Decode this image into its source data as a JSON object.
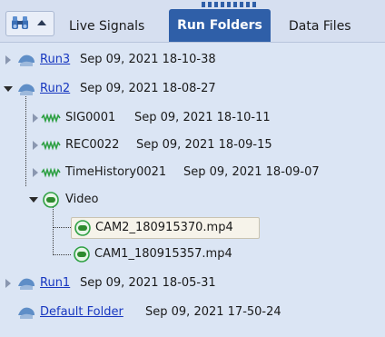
{
  "toolbar": {
    "search_icon": "binoculars-icon",
    "tabs": [
      {
        "label": "Live Signals",
        "active": false
      },
      {
        "label": "Run Folders",
        "active": true
      },
      {
        "label": "Data Files",
        "active": false
      }
    ]
  },
  "tree": {
    "run3": {
      "name": "Run3",
      "date": "Sep 09, 2021 18-10-38",
      "expanded": false
    },
    "run2": {
      "name": "Run2",
      "date": "Sep 09, 2021 18-08-27",
      "expanded": true,
      "children": {
        "sig": {
          "name": "SIG0001",
          "date": "Sep 09, 2021 18-10-11"
        },
        "rec": {
          "name": "REC0022",
          "date": "Sep 09, 2021 18-09-15"
        },
        "th": {
          "name": "TimeHistory0021",
          "date": "Sep 09, 2021 18-09-07"
        },
        "video": {
          "name": "Video",
          "expanded": true,
          "files": [
            {
              "name": "CAM2_180915370.mp4",
              "selected": true
            },
            {
              "name": "CAM1_180915357.mp4",
              "selected": false
            }
          ]
        }
      }
    },
    "run1": {
      "name": "Run1",
      "date": "Sep 09, 2021 18-05-31",
      "expanded": false
    },
    "default": {
      "name": "Default Folder",
      "date": "Sep 09, 2021 17-50-24"
    }
  },
  "colors": {
    "accent": "#2f5fa8",
    "tree_bg": "#dbe5f4",
    "link": "#1737c0",
    "signal_green": "#2ea043"
  }
}
